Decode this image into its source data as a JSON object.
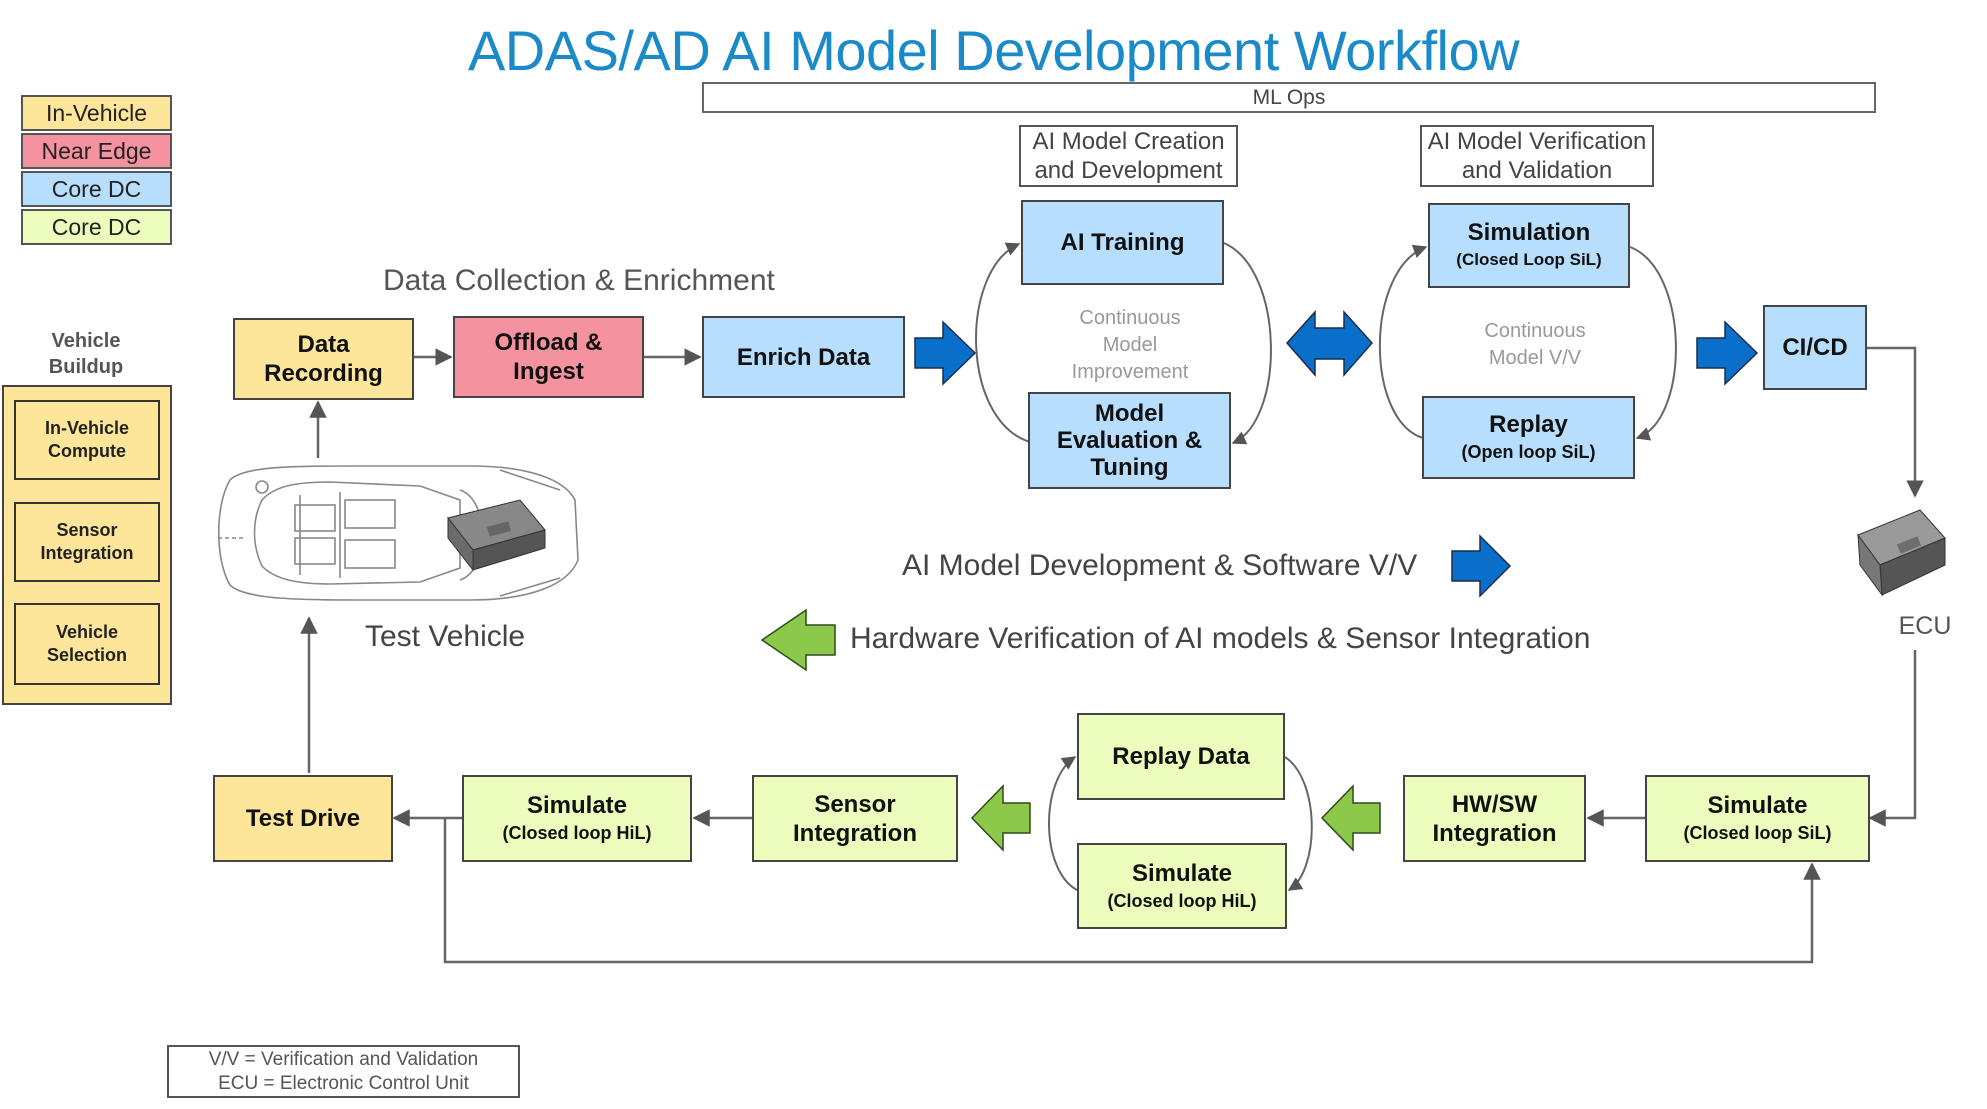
{
  "title": "ADAS/AD AI Model Development Workflow",
  "ml_ops_label": "ML Ops",
  "legend": [
    {
      "label": "In-Vehicle",
      "color": "#fde59a"
    },
    {
      "label": "Near Edge",
      "color": "#f4939f"
    },
    {
      "label": "Core DC",
      "color": "#b7dffd"
    },
    {
      "label": "Core DC",
      "color": "#ecfcbc"
    }
  ],
  "vehicle_buildup": {
    "heading_line1": "Vehicle",
    "heading_line2": "Buildup",
    "items": [
      {
        "line1": "In-Vehicle",
        "line2": "Compute"
      },
      {
        "line1": "Sensor",
        "line2": "Integration"
      },
      {
        "line1": "Vehicle",
        "line2": "Selection"
      }
    ]
  },
  "data_collection": {
    "heading": "Data Collection & Enrichment",
    "data_recording": {
      "line1": "Data",
      "line2": "Recording"
    },
    "offload_ingest": {
      "line1": "Offload &",
      "line2": "Ingest"
    },
    "enrich_data": "Enrich Data"
  },
  "model_creation": {
    "header_line1": "AI Model Creation",
    "header_line2": "and Development",
    "ai_training": "AI Training",
    "model_eval": {
      "line1": "Model",
      "line2": "Evaluation &",
      "line3": "Tuning"
    },
    "loop_label": {
      "line1": "Continuous",
      "line2": "Model",
      "line3": "Improvement"
    }
  },
  "model_verification": {
    "header_line1": "AI Model Verification",
    "header_line2": "and Validation",
    "simulation": {
      "title": "Simulation",
      "sub": "(Closed Loop SiL)"
    },
    "replay": {
      "title": "Replay",
      "sub": "(Open loop SiL)"
    },
    "loop_label": {
      "line1": "Continuous",
      "line2": "Model V/V"
    }
  },
  "cicd": "CI/CD",
  "ecu_label": "ECU",
  "test_vehicle_label": "Test Vehicle",
  "flow_labels": {
    "software": "AI Model Development & Software V/V",
    "hardware": "Hardware Verification of AI models & Sensor Integration"
  },
  "bottom_row": {
    "test_drive": "Test Drive",
    "simulate_hil": {
      "title": "Simulate",
      "sub": "(Closed loop HiL)"
    },
    "sensor_integration": {
      "line1": "Sensor",
      "line2": "Integration"
    },
    "replay_data": "Replay Data",
    "simulate_hil_loop": {
      "title": "Simulate",
      "sub": "(Closed loop HiL)"
    },
    "hw_sw_integration": {
      "line1": "HW/SW",
      "line2": "Integration"
    },
    "simulate_sil": {
      "title": "Simulate",
      "sub": "(Closed loop SiL)"
    }
  },
  "footnote": {
    "line1": "V/V = Verification and Validation",
    "line2": "ECU = Electronic Control Unit"
  },
  "colors": {
    "title": "#1a8ac8",
    "blue_arrow": "#0a6fcb",
    "green_arrow": "#8cc94a"
  }
}
